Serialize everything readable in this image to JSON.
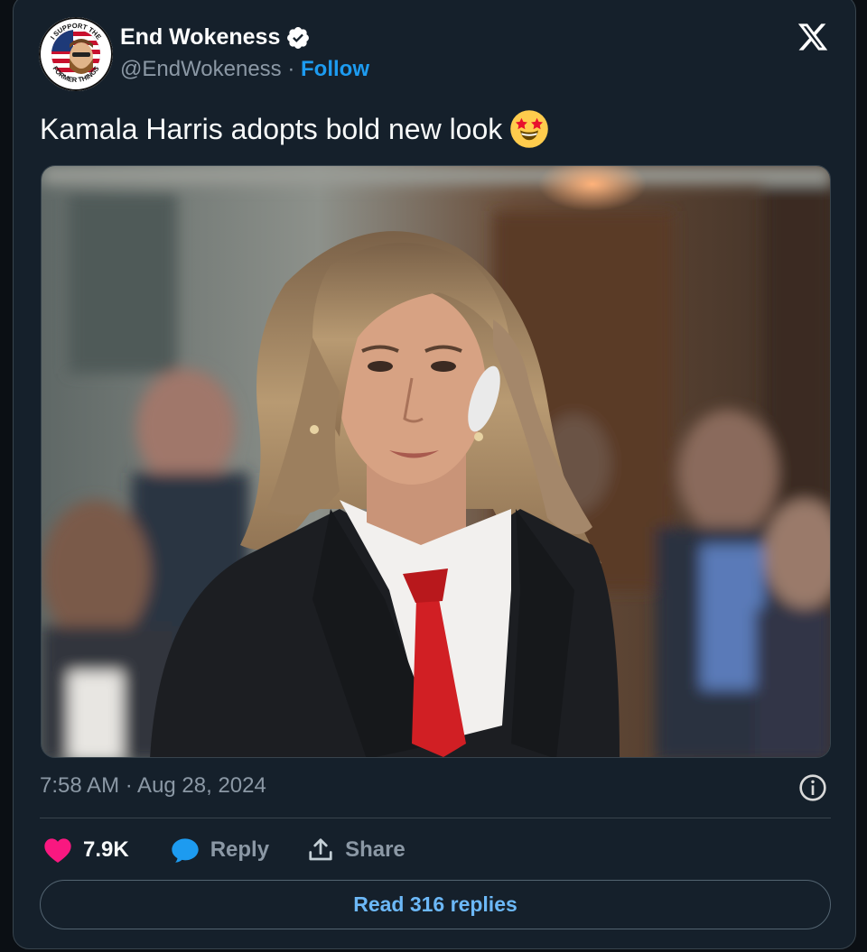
{
  "author": {
    "name": "End Wokeness",
    "handle": "@EndWokeness",
    "separator": " · ",
    "follow_label": "Follow",
    "avatar_text_top": "I SUPPORT THE",
    "avatar_text_bottom": "FORMER THINGS",
    "verified_icon": "verified-badge-icon"
  },
  "tweet": {
    "text": "Kamala Harris adopts bold new look",
    "emoji": "star-struck-emoji",
    "timestamp": "7:58 AM · Aug 28, 2024"
  },
  "media": {
    "description_icon": "photo"
  },
  "actions": {
    "like_count": "7.9K",
    "reply_label": "Reply",
    "share_label": "Share"
  },
  "read_replies_label": "Read 316 replies",
  "colors": {
    "background": "#15202b",
    "link": "#1d9bf0",
    "heart": "#f91880",
    "muted": "#8b98a5"
  }
}
